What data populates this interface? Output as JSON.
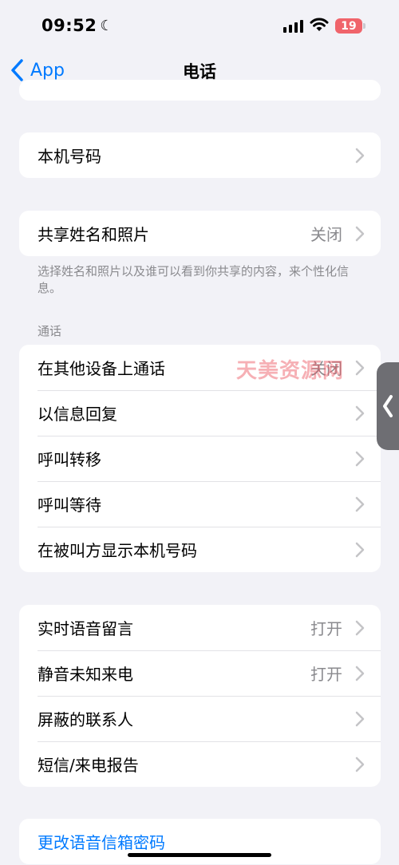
{
  "status_bar": {
    "time": "09:52",
    "battery": "19"
  },
  "nav": {
    "back_label": "App",
    "title": "电话"
  },
  "my_number": {
    "label": "本机号码"
  },
  "share_name": {
    "label": "共享姓名和照片",
    "value": "关闭",
    "footnote": "选择姓名和照片以及谁可以看到你共享的内容，来个性化信息。"
  },
  "calls_section": {
    "header": "通话",
    "items": [
      {
        "label": "在其他设备上通话",
        "value": "关闭"
      },
      {
        "label": "以信息回复",
        "value": ""
      },
      {
        "label": "呼叫转移",
        "value": ""
      },
      {
        "label": "呼叫等待",
        "value": ""
      },
      {
        "label": "在被叫方显示本机号码",
        "value": ""
      }
    ]
  },
  "voicemail_section": {
    "items": [
      {
        "label": "实时语音留言",
        "value": "打开"
      },
      {
        "label": "静音未知来电",
        "value": "打开"
      },
      {
        "label": "屏蔽的联系人",
        "value": ""
      },
      {
        "label": "短信/来电报告",
        "value": ""
      }
    ]
  },
  "change_password": {
    "label": "更改语音信箱密码"
  },
  "watermark": "天美资源网",
  "colors": {
    "accent": "#007aff",
    "background": "#f2f2f7",
    "battery": "#f0646b"
  }
}
